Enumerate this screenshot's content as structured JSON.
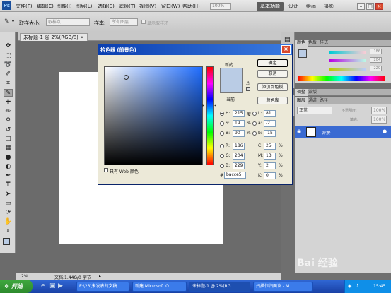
{
  "menu": {
    "items": [
      "文件(F)",
      "编辑(E)",
      "图像(I)",
      "图层(L)",
      "选择(S)",
      "滤镜(T)",
      "视图(V)",
      "窗口(W)",
      "帮助(H)"
    ],
    "zoom": "100%",
    "workspaces": {
      "active": "基本功能",
      "design": "设计",
      "painting": "绘画",
      "photography": "摄影"
    }
  },
  "options": {
    "sample_size_label": "取样大小:",
    "sample_size_value": "取样点",
    "sample_label": "样本:",
    "sample_value": "所有图层",
    "show_ring_label": "显示取样环"
  },
  "document": {
    "tab": "未标题-1 @ 2%(RGB/8)",
    "zoom": "2%",
    "doc_info": "文档:1.44G/0 字节"
  },
  "dialog": {
    "title": "拾色器 (前景色)",
    "new_label": "新的",
    "current_label": "当前",
    "buttons": {
      "ok": "确定",
      "cancel": "取消",
      "add_swatch": "添加到色板",
      "libraries": "颜色库"
    },
    "only_web": "只有 Web 颜色",
    "fields": {
      "H": "215",
      "S": "19",
      "B": "90",
      "R": "186",
      "G": "204",
      "B2": "229",
      "L": "81",
      "a": "-2",
      "b": "-15",
      "C": "25",
      "M": "13",
      "Y": "2",
      "K": "0"
    },
    "units": {
      "deg": "度",
      "pct": "%"
    },
    "hex_prefix": "#",
    "hex": "bacce5",
    "color": "#bacce5"
  },
  "panels": {
    "color_tabs": [
      "颜色",
      "色板",
      "样式"
    ],
    "color_values": [
      "186",
      "204",
      "229"
    ],
    "adjust_tabs": [
      "调整",
      "蒙版"
    ],
    "layer_tabs": [
      "图层",
      "通道",
      "路径"
    ],
    "blend_mode": "正常",
    "opacity_label": "不透明度:",
    "opacity": "100%",
    "fill_label": "填充:",
    "fill": "100%",
    "layer_name": "背景"
  },
  "taskbar": {
    "start": "开始",
    "tasks": [
      "E:\\23\\未发表的文稿",
      "新建 Microsoft O...",
      "未标题-1 @ 2%(RG...",
      "扫描作归面议 - M..."
    ],
    "time": "15:45"
  },
  "watermark": "Bai 经验"
}
